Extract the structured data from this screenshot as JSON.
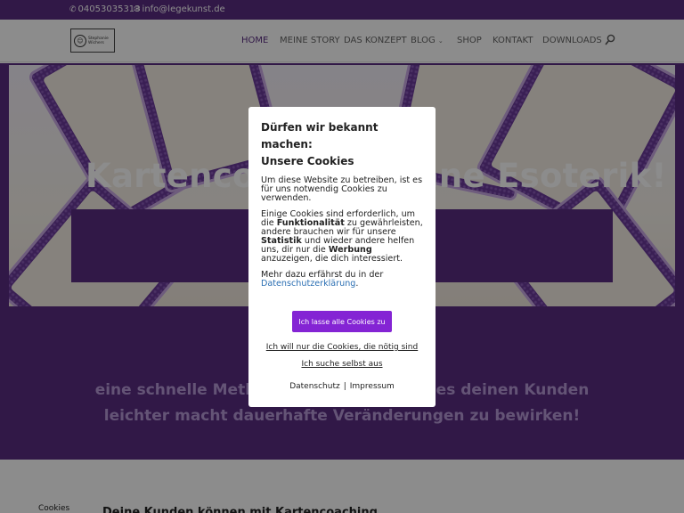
{
  "topbar": {
    "phone": "04053035313",
    "email": "info@legekunst.de"
  },
  "logo": {
    "text_line1": "Stephanie",
    "text_line2": "Wichers"
  },
  "nav": {
    "items": [
      {
        "label": "HOME",
        "active": true
      },
      {
        "label": "MEINE STORY"
      },
      {
        "label": "DAS KONZEPT"
      },
      {
        "label": "BLOG"
      },
      {
        "label": "SHOP"
      },
      {
        "label": "KONTAKT"
      },
      {
        "label": "DOWNLOADS"
      }
    ],
    "blog_caret": "⌄"
  },
  "hero": {
    "title": "Kartencoaching ohne Esoterik!"
  },
  "section": {
    "line1": "eine schnelle Methode für Coaches, die es deinen Kunden",
    "line2": "leichter macht dauerhafte Veränderungen zu bewirken!"
  },
  "bottom": {
    "cookies_tab": "Cookies",
    "heading": "Deine Kunden können mit Kartencoaching"
  },
  "cookie_modal": {
    "title_line1": "Dürfen wir bekannt machen:",
    "title_line2": "Unsere Cookies",
    "para1": "Um diese Website zu betreiben, ist es für uns notwendig Cookies zu verwenden.",
    "para2_a": "Einige Cookies sind erforderlich, um die ",
    "para2_b": "Funktionalität",
    "para2_c": " zu gewährleisten, andere brauchen wir für unsere ",
    "para2_d": "Statistik",
    "para2_e": " und wieder andere helfen uns, dir nur die ",
    "para2_f": "Werbung",
    "para2_g": " anzuzeigen, die dich interessiert.",
    "para3_a": "Mehr dazu erfährst du in der ",
    "para3_link": "Datenschutzerklärung",
    "para3_b": ".",
    "accept_label": "Ich lasse alle Cookies zu",
    "necessary_label": "Ich will nur die Cookies, die nötig sind",
    "choose_label": "Ich suche selbst aus",
    "privacy_label": "Datenschutz",
    "separator": "|",
    "imprint_label": "Impressum"
  },
  "colors": {
    "brand_purple": "#5a2d82",
    "accept_button": "#8424d4",
    "link_blue": "#2b6fb3",
    "subtext_lilac": "#b79ad7"
  }
}
